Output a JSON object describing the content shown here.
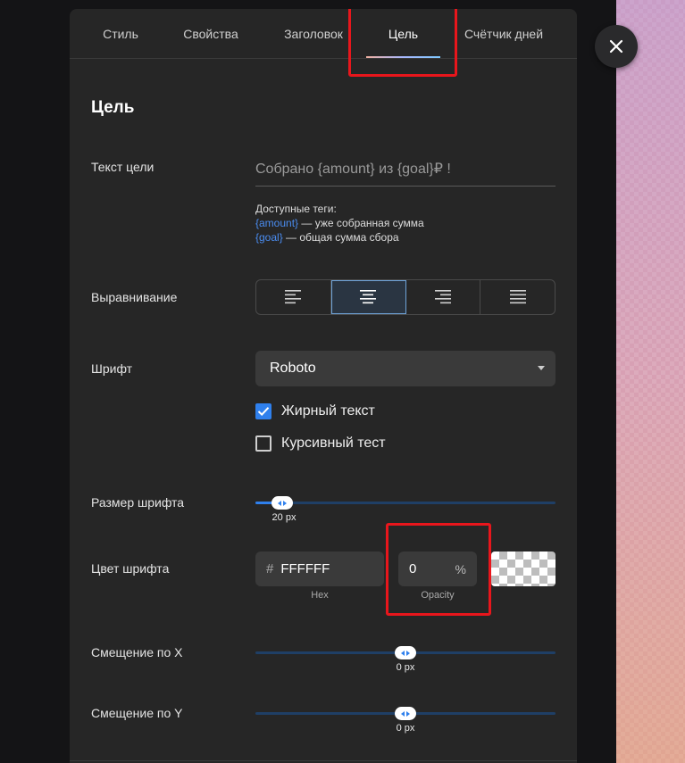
{
  "tabs": [
    {
      "label": "Стиль"
    },
    {
      "label": "Свойства"
    },
    {
      "label": "Заголовок"
    },
    {
      "label": "Цель",
      "active": true
    },
    {
      "label": "Счётчик дней"
    }
  ],
  "section": {
    "title": "Цель"
  },
  "goal_text": {
    "label": "Текст цели",
    "value": "Собрано {amount} из {goal}₽ !",
    "tags_heading": "Доступные теги:",
    "tags": [
      {
        "tag": "{amount}",
        "desc": " — уже собранная сумма"
      },
      {
        "tag": "{goal}",
        "desc": " — общая сумма сбора"
      }
    ]
  },
  "alignment": {
    "label": "Выравнивание",
    "options": [
      "left",
      "center",
      "right",
      "justify"
    ],
    "selected": "center"
  },
  "font": {
    "label": "Шрифт",
    "value": "Roboto",
    "bold_label": "Жирный текст",
    "bold": true,
    "italic_label": "Курсивный тест",
    "italic": false
  },
  "font_size": {
    "label": "Размер шрифта",
    "value_text": "20 px",
    "value": 20,
    "min": 0,
    "max": 200
  },
  "font_color": {
    "label": "Цвет шрифта",
    "hex": "FFFFFF",
    "hex_hash": "#",
    "hex_caption": "Hex",
    "opacity": "0",
    "opacity_unit": "%",
    "opacity_caption": "Opacity"
  },
  "offset_x": {
    "label": "Смещение по X",
    "value_text": "0 px",
    "value": 0,
    "min": -100,
    "max": 100
  },
  "offset_y": {
    "label": "Смещение по Y",
    "value_text": "0 px",
    "value": 0,
    "min": -100,
    "max": 100
  },
  "colors": {
    "accent": "#2f80ed",
    "highlight": "#e8161c",
    "panel": "#262626"
  },
  "icons": {
    "close": "close-icon",
    "dropdown": "chevron-down-icon",
    "check": "check-icon"
  }
}
